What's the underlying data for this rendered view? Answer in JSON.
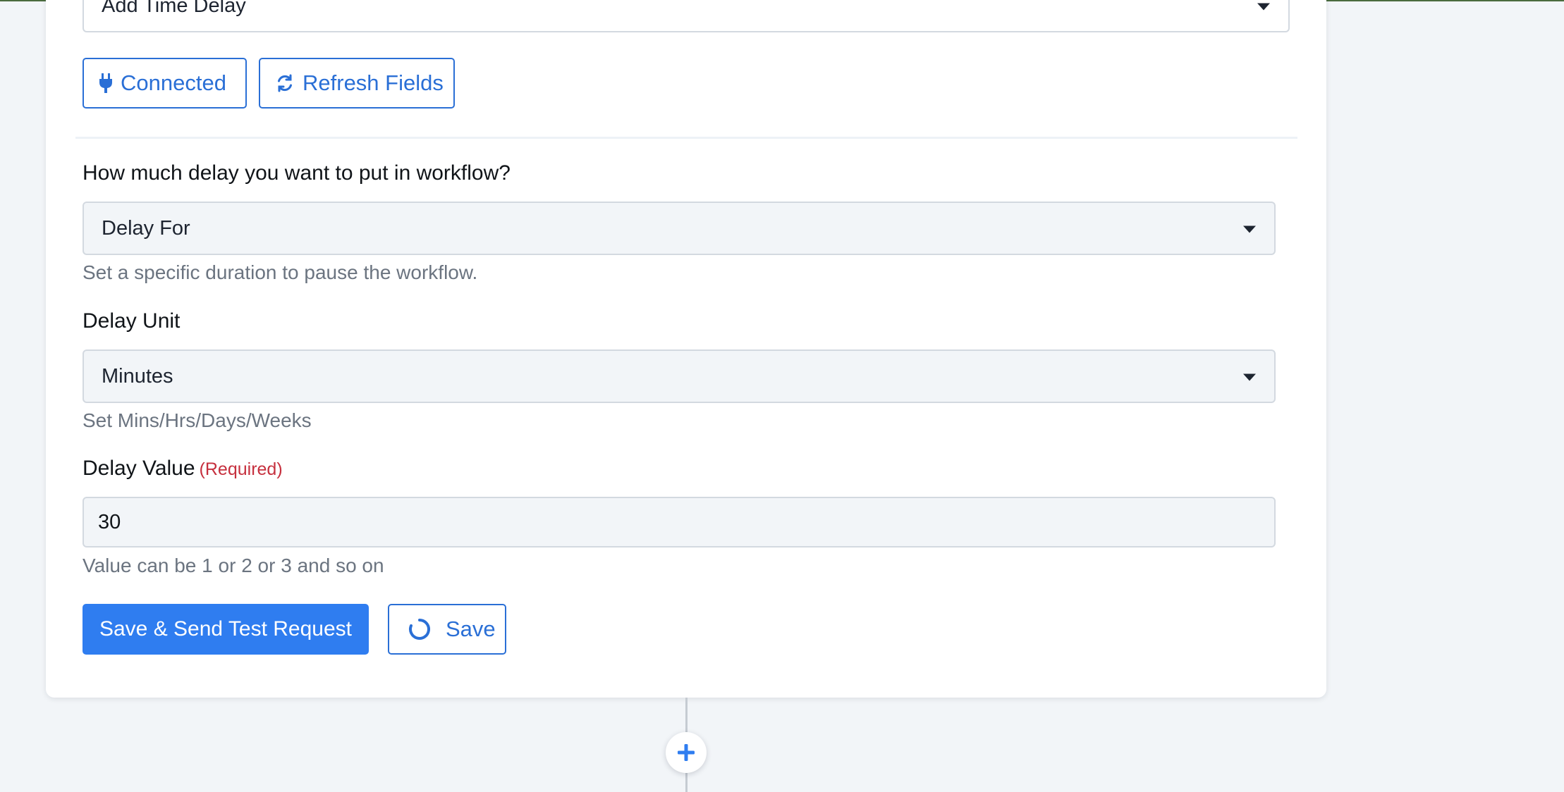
{
  "action_select": {
    "value": "Add Time Delay"
  },
  "buttons": {
    "connected": "Connected",
    "refresh_fields": "Refresh Fields",
    "save_send_test": "Save & Send Test Request",
    "save": "Save"
  },
  "delay_type": {
    "label": "How much delay you want to put in workflow?",
    "value": "Delay For",
    "help": "Set a specific duration to pause the workflow."
  },
  "delay_unit": {
    "label": "Delay Unit",
    "value": "Minutes",
    "help": "Set Mins/Hrs/Days/Weeks"
  },
  "delay_value": {
    "label": "Delay Value",
    "required": "(Required)",
    "value": "30",
    "help": "Value can be 1 or 2 or 3 and so on"
  },
  "icons": {
    "connected": "plug-icon",
    "refresh": "refresh-icon",
    "save": "spinner-icon",
    "add_step": "plus-icon",
    "dropdown": "caret-down-icon"
  },
  "colors": {
    "accent": "#2f7df0",
    "required": "#c6303e",
    "background": "#f2f5f8"
  }
}
